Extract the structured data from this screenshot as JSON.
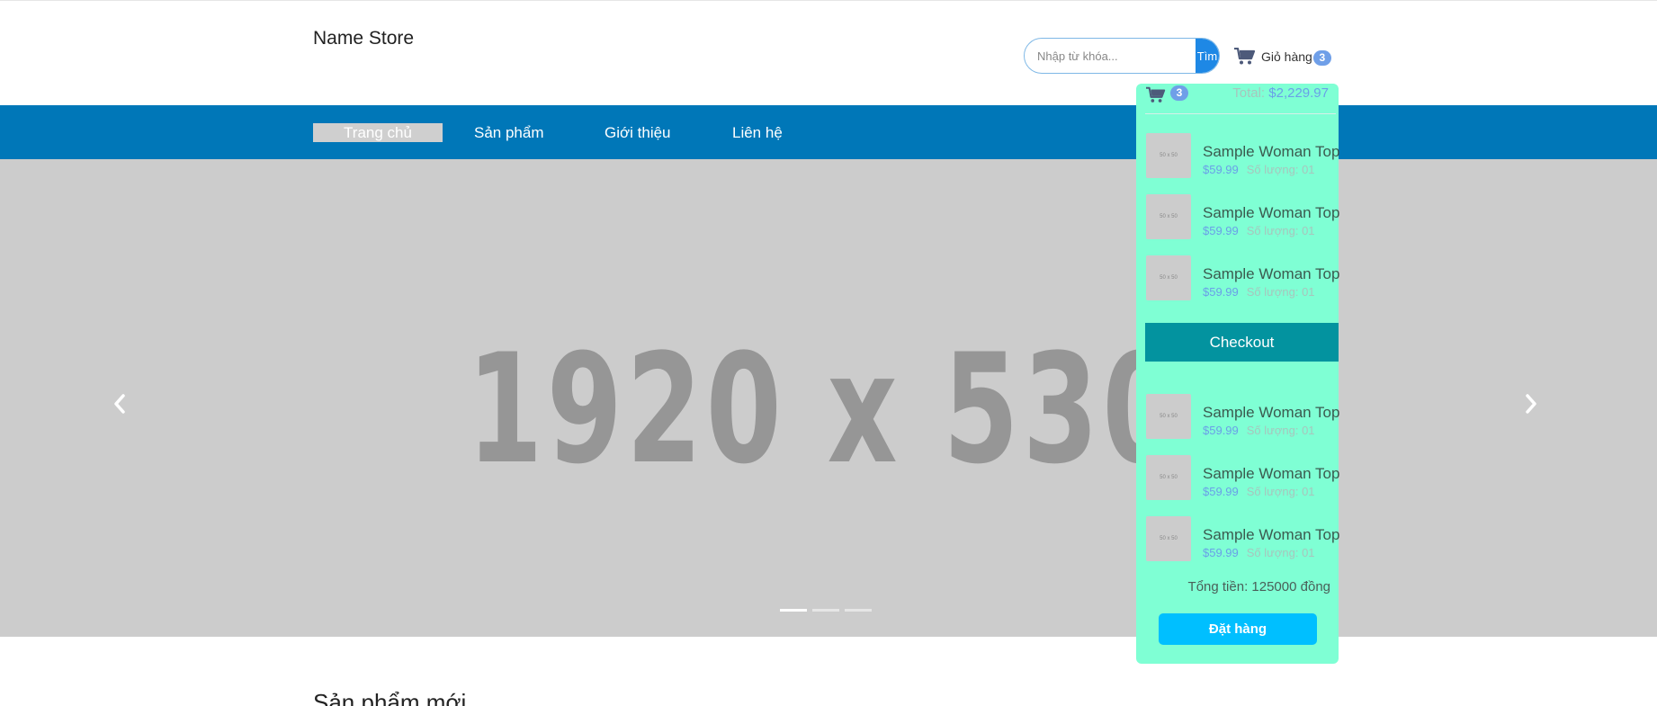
{
  "header": {
    "store_name": "Name Store",
    "search": {
      "placeholder": "Nhập từ khóa...",
      "button_label": "Tìm"
    },
    "cart": {
      "label": "Giỏ hàng",
      "count": "3"
    }
  },
  "nav": {
    "items": [
      {
        "label": "Trang chủ",
        "active": true
      },
      {
        "label": "Sản phẩm"
      },
      {
        "label": "Giới thiệu"
      },
      {
        "label": "Liên hệ"
      }
    ]
  },
  "slider": {
    "placeholder_text": "1920 x 530",
    "active_slide": 1,
    "total_slides": 3
  },
  "section": {
    "title": "Sản phẩm mới"
  },
  "cart_panel": {
    "count": "3",
    "total_label": "Total:",
    "total_value": "$2,229.97",
    "items": [
      {
        "thumb": "50 x 50",
        "name": "Sample Woman Top",
        "price": "$59.99",
        "qty": "Số lượng: 01"
      },
      {
        "thumb": "50 x 50",
        "name": "Sample Woman Top",
        "price": "$59.99",
        "qty": "Số lượng: 01"
      },
      {
        "thumb": "50 x 50",
        "name": "Sample Woman Top",
        "price": "$59.99",
        "qty": "Số lượng: 01"
      },
      {
        "thumb": "50 x 50",
        "name": "Sample Woman Top",
        "price": "$59.99",
        "qty": "Số lượng: 01"
      },
      {
        "thumb": "50 x 50",
        "name": "Sample Woman Top",
        "price": "$59.99",
        "qty": "Số lượng: 01"
      },
      {
        "thumb": "50 x 50",
        "name": "Sample Woman Top",
        "price": "$59.99",
        "qty": "Số lượng: 01"
      }
    ],
    "checkout_label": "Checkout",
    "sum_text": "Tổng tiền: 125000 đồng",
    "order_label": "Đặt hàng"
  },
  "colors": {
    "nav_bg": "#0077b8",
    "panel_bg": "#7fffd4",
    "checkout_bg": "#03939f",
    "order_bg": "#00bfff",
    "badge_bg": "#6f9fe8"
  },
  "icons": [
    "cart-icon",
    "chevron-left-icon",
    "chevron-right-icon"
  ]
}
